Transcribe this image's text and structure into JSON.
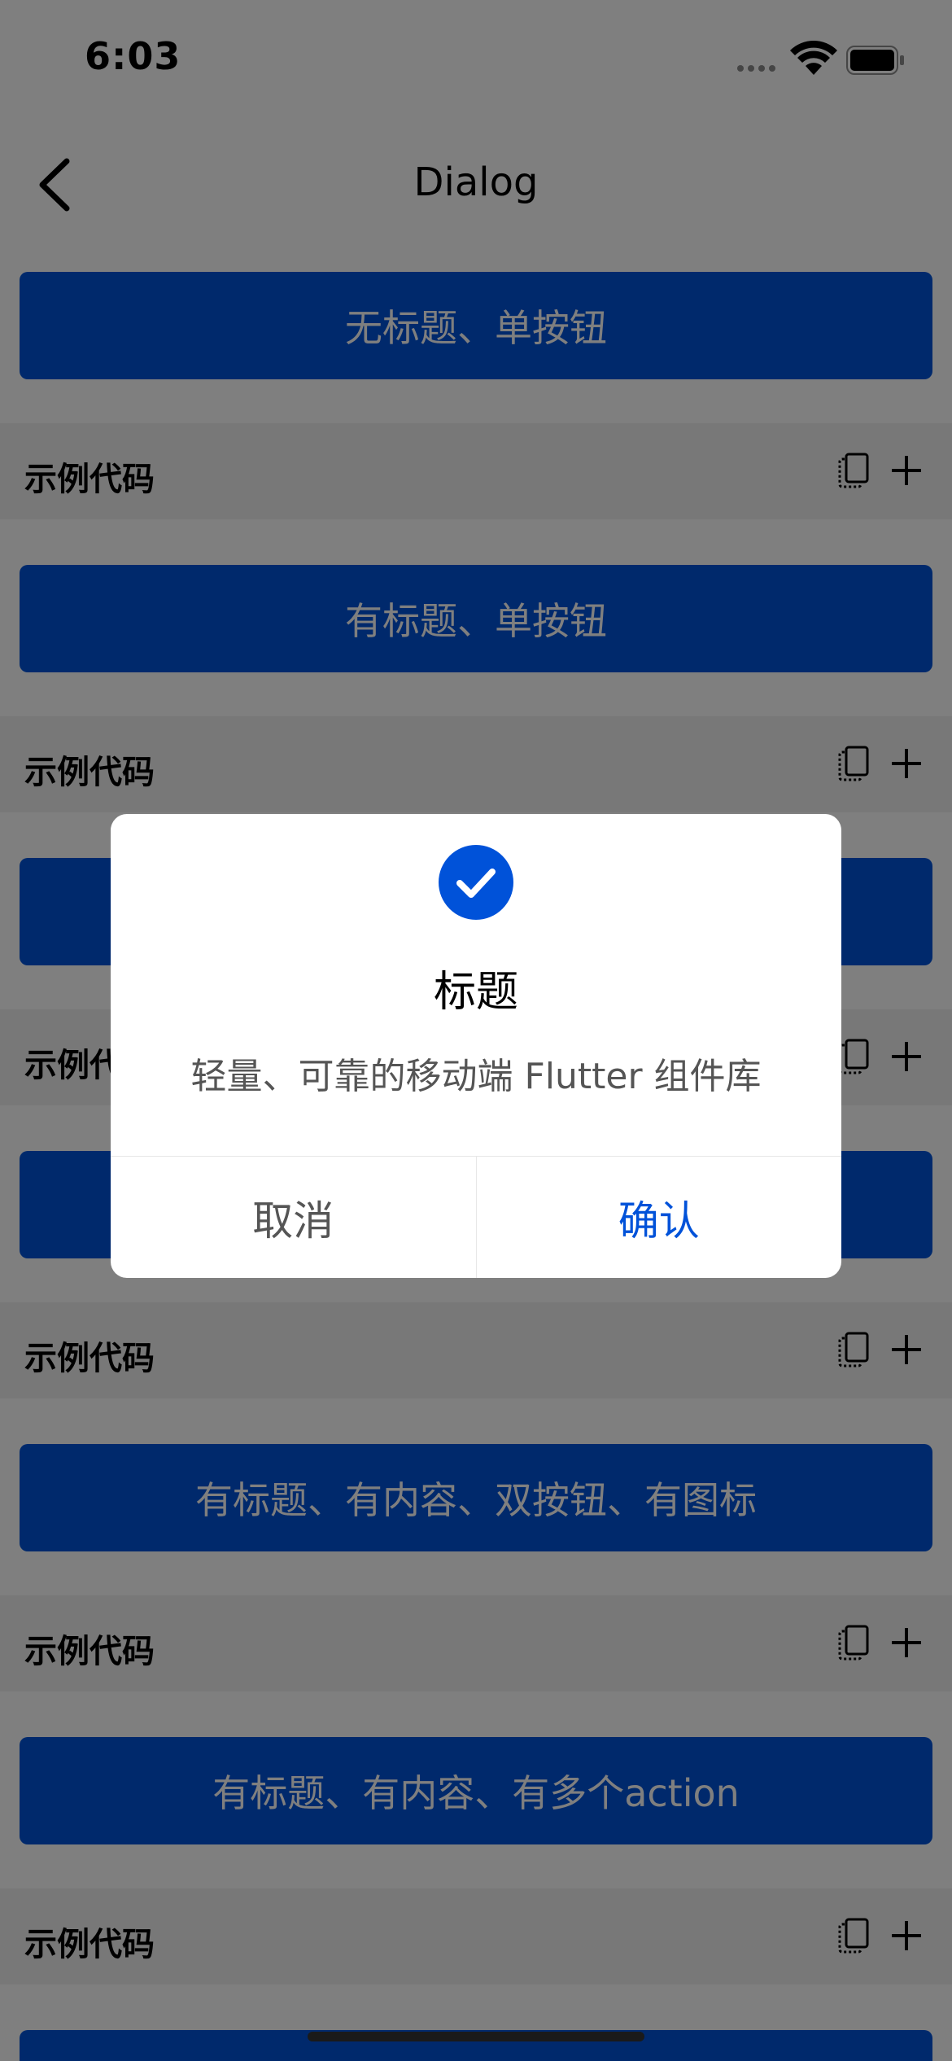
{
  "status_bar": {
    "time": "6:03"
  },
  "nav": {
    "title": "Dialog"
  },
  "demos": [
    {
      "button_label": "无标题、单按钮",
      "code_label": "示例代码"
    },
    {
      "button_label": "有标题、单按钮",
      "code_label": "示例代码"
    },
    {
      "button_label": "",
      "code_label": "示例代码"
    },
    {
      "button_label": "",
      "code_label": "示例代码"
    },
    {
      "button_label": "有标题、有内容、双按钮、有图标",
      "code_label": "示例代码"
    },
    {
      "button_label": "有标题、有内容、有多个action",
      "code_label": "示例代码"
    }
  ],
  "dialog": {
    "title": "标题",
    "content": "轻量、可靠的移动端 Flutter 组件库",
    "cancel_label": "取消",
    "confirm_label": "确认"
  },
  "colors": {
    "primary": "#0052d9",
    "code_bar_bg": "#f0f0f0",
    "overlay": "rgba(0,0,0,0.5)"
  }
}
